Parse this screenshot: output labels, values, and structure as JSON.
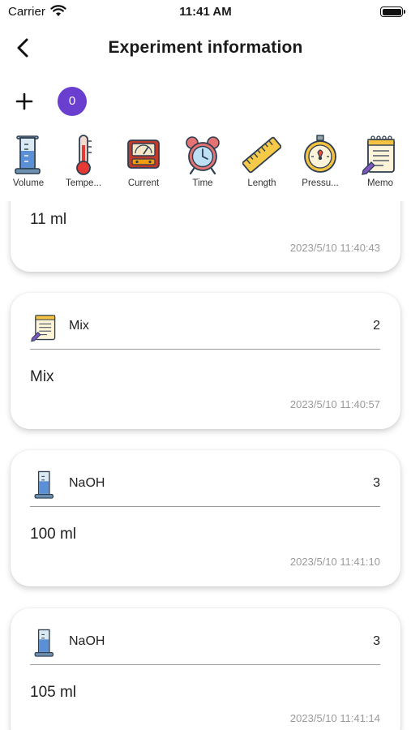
{
  "status_bar": {
    "carrier": "Carrier",
    "time": "11:41 AM"
  },
  "header": {
    "title": "Experiment information"
  },
  "toolbar": {
    "count": "0"
  },
  "tools": [
    {
      "label": "Volume",
      "icon": "graduated-cylinder-icon"
    },
    {
      "label": "Tempe...",
      "icon": "thermometer-icon"
    },
    {
      "label": "Current",
      "icon": "ammeter-icon"
    },
    {
      "label": "Time",
      "icon": "alarm-clock-icon"
    },
    {
      "label": "Length",
      "icon": "ruler-icon"
    },
    {
      "label": "Pressu...",
      "icon": "pressure-gauge-icon"
    },
    {
      "label": "Memo",
      "icon": "memo-icon"
    }
  ],
  "records": [
    {
      "value": "11 ml",
      "time": "2023/5/10   11:40:43"
    },
    {
      "name": "Mix",
      "index": "2",
      "icon": "memo-icon",
      "value": "Mix",
      "time": "2023/5/10   11:40:57"
    },
    {
      "name": "NaOH",
      "index": "3",
      "icon": "graduated-cylinder-icon",
      "value": "100 ml",
      "time": "2023/5/10   11:41:10"
    },
    {
      "name": "NaOH",
      "index": "3",
      "icon": "graduated-cylinder-icon",
      "value": "105 ml",
      "time": "2023/5/10   11:41:14"
    }
  ],
  "colors": {
    "accent": "#6a3fd0",
    "divider": "#9a9a9a",
    "timestamp": "#9a9a9a"
  }
}
